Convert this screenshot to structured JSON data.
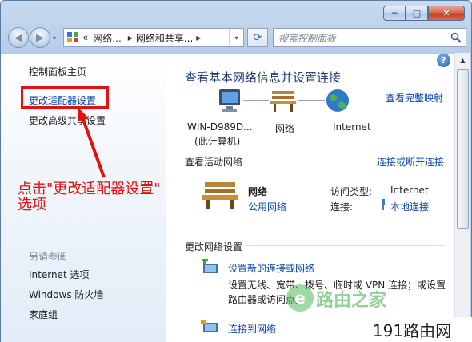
{
  "window": {
    "caption_min": "─",
    "caption_max": "□",
    "caption_close": "✕"
  },
  "navbar": {
    "back_glyph": "◀",
    "forward_glyph": "▶",
    "history_glyph": "▾",
    "breadcrumb_prefix": "«",
    "breadcrumb": [
      "网络...",
      "网络和共享..."
    ],
    "separator": "▸",
    "refresh_glyph": "⟳",
    "search_placeholder": "搜索控制面板"
  },
  "sidebar": {
    "home": "控制面板主页",
    "adapter_settings": "更改适配器设置",
    "advanced_sharing": "更改高级共享设置",
    "see_also": "另请参阅",
    "see_also_items": [
      "Internet 选项",
      "Windows 防火墙",
      "家庭组"
    ]
  },
  "annotation": {
    "line1": "点击\"更改适配器设置\"",
    "line2": "选项",
    "color": "#e4100f"
  },
  "main": {
    "heading": "查看基本网络信息并设置连接",
    "view_full_map": "查看完整映射",
    "map_nodes": [
      {
        "label": "WIN-D989D...",
        "sublabel": "(此计算机)"
      },
      {
        "label": "网络"
      },
      {
        "label": "Internet"
      }
    ],
    "active_networks_title": "查看活动网络",
    "connect_disconnect": "连接或断开连接",
    "network": {
      "name": "网络",
      "type": "公用网络",
      "access_type_label": "访问类型:",
      "access_type_value": "Internet",
      "connections_label": "连接:",
      "connections_value": "本地连接"
    },
    "change_settings_title": "更改网络设置",
    "tasks": [
      {
        "title": "设置新的连接或网络",
        "desc_line1": "设置无线、宽带、拨号、临时或 VPN 连接；或设置",
        "desc_line2": "路由器或访问点。"
      },
      {
        "title": "连接到网络"
      }
    ]
  },
  "watermark": {
    "logo_letter": "e",
    "text": "路由之家"
  },
  "brand": {
    "text": "191路由网"
  },
  "help_glyph": "?"
}
